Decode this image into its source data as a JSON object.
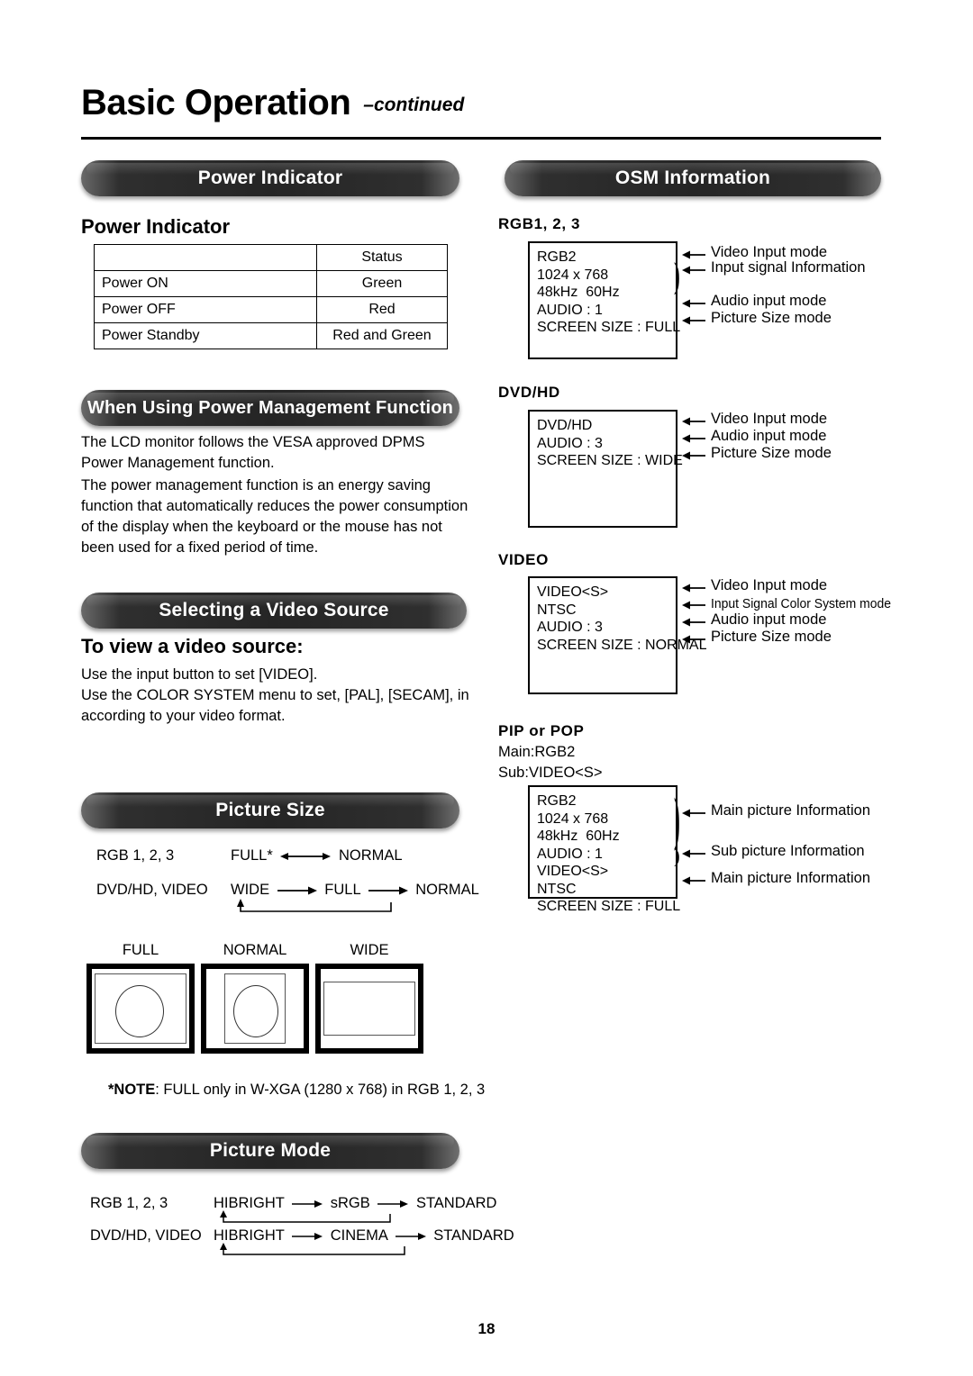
{
  "header": {
    "title": "Basic Operation",
    "continued": "–continued"
  },
  "page_number": "18",
  "left_column": {
    "power_indicator": {
      "pill_label": "Power Indicator",
      "sub_heading": "Power Indicator",
      "table": {
        "columns": [
          "",
          "Status"
        ],
        "rows": [
          [
            "Power ON",
            "Green"
          ],
          [
            "Power OFF",
            "Red"
          ],
          [
            "Power Standby",
            "Red and Green"
          ]
        ]
      }
    },
    "power_management": {
      "pill_label": "When Using Power Management Function",
      "paragraph_1": "The LCD monitor follows the VESA approved DPMS Power Management function.",
      "paragraph_2": "The power management function is an energy saving function that automatically reduces the power consumption of the display when the keyboard or the mouse has not been used for a fixed period of time."
    },
    "video_source": {
      "pill_label": "Selecting a Video Source",
      "sub_heading": "To view a video source:",
      "paragraph_1": "Use the input button to set [VIDEO].",
      "paragraph_2": "Use the COLOR SYSTEM menu to set, [PAL], [SECAM], in according to your video format."
    },
    "picture_size": {
      "pill_label": "Picture Size",
      "rows": [
        {
          "source": "RGB 1, 2, 3",
          "steps": [
            "FULL*",
            "NORMAL"
          ],
          "bidirectional": true,
          "loop": false
        },
        {
          "source": "DVD/HD, VIDEO",
          "steps": [
            "WIDE",
            "FULL",
            "NORMAL"
          ],
          "bidirectional": false,
          "loop": true
        }
      ],
      "illustrations": [
        {
          "caption": "FULL",
          "style": "full"
        },
        {
          "caption": "NORMAL",
          "style": "normal"
        },
        {
          "caption": "WIDE",
          "style": "wide"
        }
      ],
      "note_prefix": "*NOTE",
      "note_text": ": FULL only in W-XGA (1280 x 768) in RGB 1, 2, 3"
    },
    "picture_mode": {
      "pill_label": "Picture Mode",
      "rows": [
        {
          "source": "RGB 1, 2, 3",
          "steps": [
            "HIBRIGHT",
            "sRGB",
            "STANDARD"
          ],
          "loop": true
        },
        {
          "source": "DVD/HD, VIDEO",
          "steps": [
            "HIBRIGHT",
            "CINEMA",
            "STANDARD"
          ],
          "loop": true
        }
      ]
    }
  },
  "right_column": {
    "osm": {
      "pill_label": "OSM Information",
      "groups": [
        {
          "label": "RGB1, 2, 3",
          "box_lines": [
            "RGB2",
            "1024 x 768",
            "48kHz  60Hz",
            "AUDIO : 1",
            "SCREEN SIZE : FULL"
          ],
          "annotations": [
            "Video Input mode",
            "Input signal Information",
            "Audio input mode",
            "Picture Size mode"
          ]
        },
        {
          "label": "DVD/HD",
          "box_lines": [
            "DVD/HD",
            "AUDIO : 3",
            "SCREEN SIZE : WIDE"
          ],
          "annotations": [
            "Video Input mode",
            "Audio input mode",
            "Picture Size mode"
          ]
        },
        {
          "label": "VIDEO",
          "box_lines": [
            "VIDEO<S>",
            "NTSC",
            "AUDIO : 3",
            "SCREEN SIZE : NORMAL"
          ],
          "annotations": [
            "Video Input mode",
            "Input Signal Color System mode",
            "Audio input mode",
            "Picture Size mode"
          ]
        },
        {
          "label": "PIP or POP",
          "pre_lines": [
            "Main:RGB2",
            "Sub:VIDEO<S>"
          ],
          "box_lines": [
            "RGB2",
            "1024 x 768",
            "48kHz  60Hz",
            "AUDIO : 1",
            "VIDEO<S>",
            "NTSC",
            "SCREEN SIZE : FULL"
          ],
          "annotations": [
            "Main picture Information",
            "Sub picture Information",
            "Main picture Information"
          ]
        }
      ]
    }
  }
}
